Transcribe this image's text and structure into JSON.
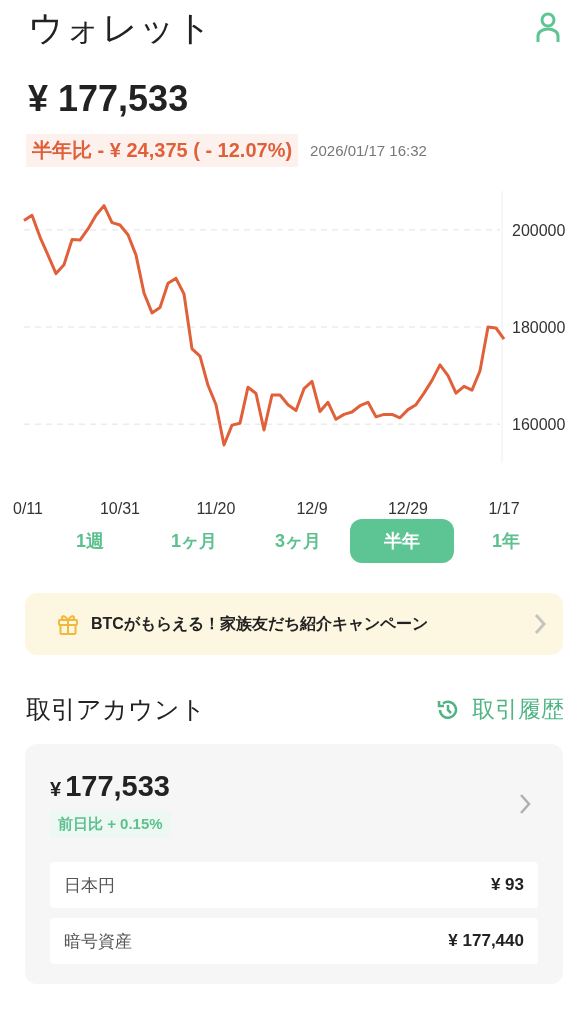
{
  "header": {
    "title": "ウォレット"
  },
  "total": {
    "amount": "¥ 177,533",
    "change": "半年比 - ¥ 24,375 ( - 12.07%)",
    "timestamp": "2026/01/17 16:32"
  },
  "chart": {
    "chart_data": {
      "type": "line",
      "categories": [
        "0/11",
        null,
        null,
        null,
        null,
        null,
        null,
        null,
        null,
        null,
        null,
        null,
        "10/31",
        null,
        null,
        null,
        null,
        null,
        null,
        null,
        null,
        null,
        null,
        null,
        "11/20",
        null,
        null,
        null,
        null,
        null,
        null,
        null,
        null,
        null,
        null,
        null,
        "12/9",
        null,
        null,
        null,
        null,
        null,
        null,
        null,
        null,
        null,
        null,
        null,
        "12/29",
        null,
        null,
        null,
        null,
        null,
        null,
        null,
        null,
        null,
        null,
        null,
        "1/17"
      ],
      "series": [
        {
          "color": "#e0603a",
          "values": [
            201900,
            203000,
            198500,
            194800,
            191000,
            192800,
            198000,
            197900,
            200200,
            203000,
            205000,
            201500,
            201000,
            199000,
            194800,
            187000,
            182900,
            184000,
            189000,
            190000,
            186800,
            175500,
            174000,
            168000,
            164000,
            155700,
            159800,
            160200,
            167600,
            166300,
            158800,
            166000,
            166000,
            164000,
            162800,
            167300,
            168800,
            162600,
            164500,
            161000,
            162000,
            162500,
            163800,
            164500,
            161500,
            162000,
            162000,
            161300,
            163000,
            164000,
            166400,
            169000,
            172200,
            170000,
            166400,
            167800,
            167000,
            171000,
            180000,
            179800,
            177500
          ]
        }
      ],
      "grid": true,
      "ylim": [
        152000,
        208000
      ],
      "yticks": [
        160000,
        180000,
        200000
      ]
    }
  },
  "periods": [
    {
      "label": "1週",
      "selected": false
    },
    {
      "label": "1ヶ月",
      "selected": false
    },
    {
      "label": "3ヶ月",
      "selected": false
    },
    {
      "label": "半年",
      "selected": true
    },
    {
      "label": "1年",
      "selected": false
    }
  ],
  "banner": {
    "text": "BTCがもらえる！家族友だち紹介キャンペーン"
  },
  "section": {
    "title": "取引アカウント",
    "link": "取引履歴"
  },
  "account": {
    "currency": "¥",
    "amount": "177,533",
    "change": "前日比 + 0.15%",
    "rows": [
      {
        "label": "日本円",
        "value": "¥ 93"
      },
      {
        "label": "暗号資産",
        "value": "¥ 177,440"
      }
    ]
  }
}
